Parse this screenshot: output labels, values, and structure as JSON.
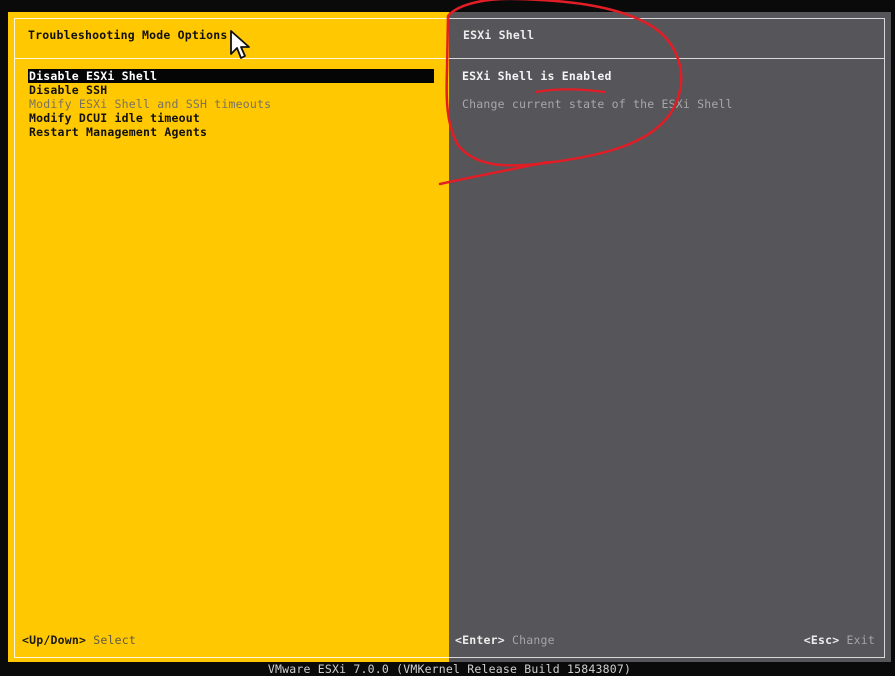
{
  "left_panel": {
    "title": "Troubleshooting Mode Options",
    "menu_items": [
      {
        "label": "Disable ESXi Shell"
      },
      {
        "label": "Disable SSH"
      },
      {
        "label": "Modify ESXi Shell and SSH timeouts"
      },
      {
        "label": "Modify DCUI idle timeout"
      },
      {
        "label": "Restart Management Agents"
      }
    ],
    "hint_key": "<Up/Down>",
    "hint_action": "Select"
  },
  "right_panel": {
    "title": "ESXi Shell",
    "status": "ESXi Shell is Enabled",
    "description": "Change current state of the ESXi Shell",
    "enter_key": "<Enter>",
    "enter_action": "Change",
    "esc_key": "<Esc>",
    "esc_action": "Exit"
  },
  "footer": {
    "text": "VMware ESXi 7.0.0 (VMKernel Release Build 15843807)"
  },
  "colors": {
    "left_background": "#ffc800",
    "right_background": "#55555a",
    "annotation": "#e21d26"
  }
}
